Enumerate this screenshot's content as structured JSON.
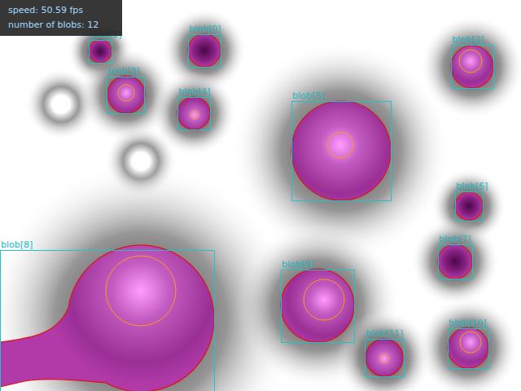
{
  "overlay": {
    "lines": [
      "speed:  50.59 fps",
      "number of blobs: 12"
    ]
  },
  "blobs": [
    {
      "label": "blob[0]",
      "core": false
    },
    {
      "label": "blob[1]",
      "core": false
    },
    {
      "label": "blob[2]",
      "core": true
    },
    {
      "label": "blob[3]",
      "core": true
    },
    {
      "label": "blob[4]",
      "core": true
    },
    {
      "label": "blob[5]",
      "core": true
    },
    {
      "label": "blob[6]",
      "core": false
    },
    {
      "label": "blob[7]",
      "core": false
    },
    {
      "label": "blob[8]",
      "core": true
    },
    {
      "label": "blob[9]",
      "core": true
    },
    {
      "label": "blob[10]",
      "core": true
    },
    {
      "label": "blob[11]",
      "core": true
    }
  ]
}
